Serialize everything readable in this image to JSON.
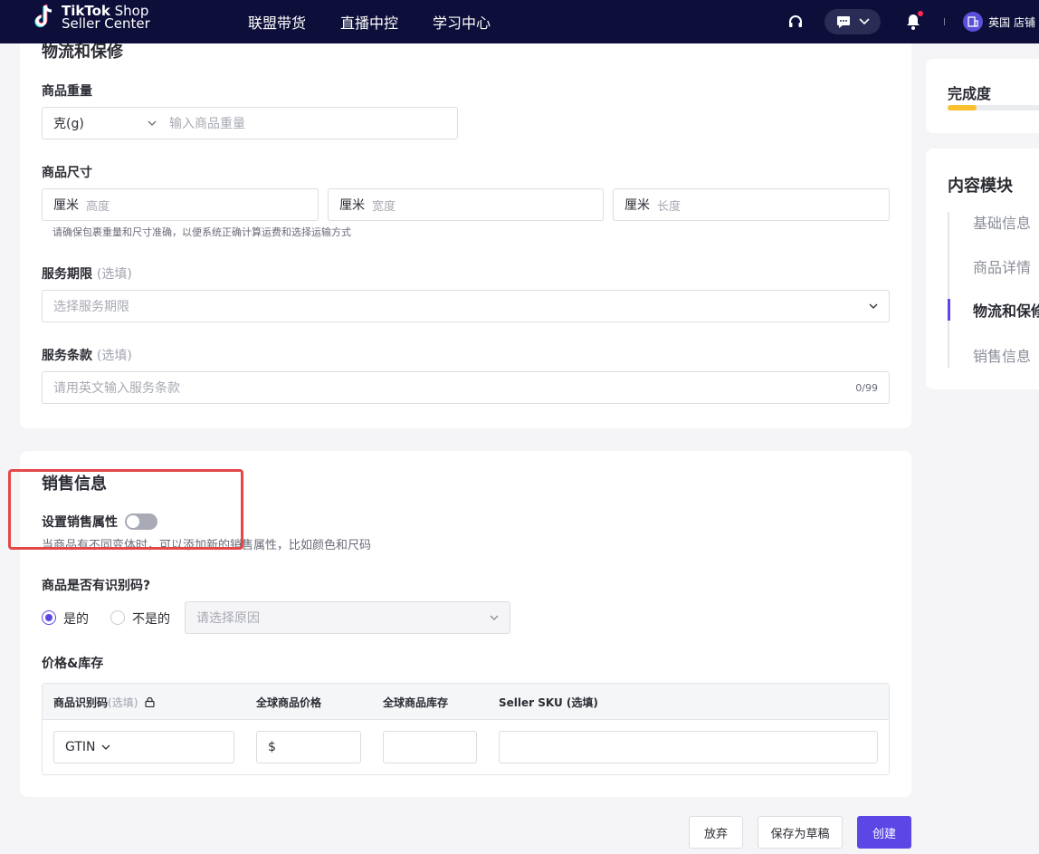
{
  "header": {
    "logo_line1_bold": "TikTok",
    "logo_line1_thin": " Shop",
    "logo_line2": "Seller Center",
    "nav": [
      "联盟带货",
      "直播中控",
      "学习中心"
    ],
    "store_label": "英国 店铺"
  },
  "logistics": {
    "title": "物流和保修",
    "weight_label": "商品重量",
    "weight_unit": "克(g)",
    "weight_placeholder": "输入商品重量",
    "size_label": "商品尺寸",
    "size_unit": "厘米",
    "height_placeholder": "高度",
    "width_placeholder": "宽度",
    "length_placeholder": "长度",
    "size_hint": "请确保包裹重量和尺寸准确，以便系统正确计算运费和选择运输方式",
    "service_period_label": "服务期限",
    "optional": "(选填)",
    "service_period_placeholder": "选择服务期限",
    "service_terms_label": "服务条款",
    "service_terms_placeholder": "请用英文输入服务条款",
    "service_terms_count": "0/99"
  },
  "sales": {
    "title": "销售信息",
    "attr_label": "设置销售属性",
    "attr_hint": "当商品有不同变体时，可以添加新的销售属性，比如颜色和尺码",
    "attr_enabled": false,
    "identifier_label": "商品是否有识别码?",
    "yes_label": "是的",
    "no_label": "不是的",
    "selected": "yes",
    "reason_placeholder": "请选择原因",
    "price_stock_label": "价格&库存",
    "table": {
      "col_identifier": "商品识别码",
      "col_identifier_opt": "(选填)",
      "col_price": "全球商品价格",
      "col_stock": "全球商品库存",
      "col_sku": "Seller SKU (选填)",
      "identifier_type": "GTIN",
      "currency": "$"
    }
  },
  "sidebar": {
    "completion_title": "完成度",
    "completion_fraction": 0.27,
    "modules_title": "内容模块",
    "modules": [
      "基础信息",
      "商品详情",
      "物流和保修",
      "销售信息"
    ],
    "active_index": 2
  },
  "footer": {
    "discard": "放弃",
    "save_draft": "保存为草稿",
    "create": "创建"
  }
}
